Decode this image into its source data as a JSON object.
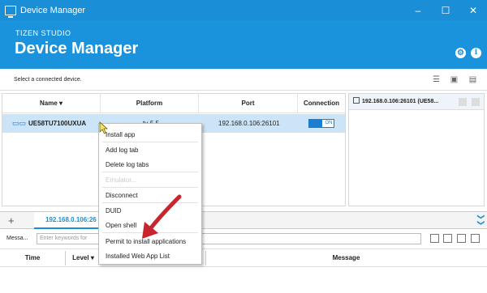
{
  "window": {
    "title": "Device Manager",
    "controls": [
      "–",
      "☐",
      "✕"
    ]
  },
  "banner": {
    "subtitle": "TIZEN STUDIO",
    "title": "Device Manager"
  },
  "select_hint": "Select a connected device.",
  "device_table": {
    "headers": {
      "name": "Name ▾",
      "platform": "Platform",
      "port": "Port",
      "connection": "Connection"
    },
    "row": {
      "name": "UE58TU7100UXUA",
      "platform": "tv-5.5",
      "port": "192.168.0.106:26101",
      "toggle_label": "ON"
    }
  },
  "right_panel": {
    "tab_label": "192.168.0.106:26101 (UE58..."
  },
  "context_menu": {
    "install_app": "Install app",
    "add_log_tab": "Add log tab",
    "delete_log_tabs": "Delete log tabs",
    "disabled_item": "Emulator...",
    "disconnect": "Disconnect",
    "duid": "DUID",
    "open_shell": "Open shell",
    "permit": "Permit to install applications",
    "installed_list": "Installed Web App List"
  },
  "log": {
    "add_tab": "+",
    "tab_label": "192.168.0.106:26",
    "collapse": "❯❯",
    "message_label": "Messa...",
    "filter_placeholder": "Enter keywords for",
    "headers": {
      "time": "Time",
      "level": "Level ▾",
      "message": "Message"
    }
  },
  "colors": {
    "title_bar": "#1a8fd8",
    "banner": "#1b92dc",
    "row_selected": "#cce4f7",
    "annotation_arrow": "#c8252c"
  }
}
